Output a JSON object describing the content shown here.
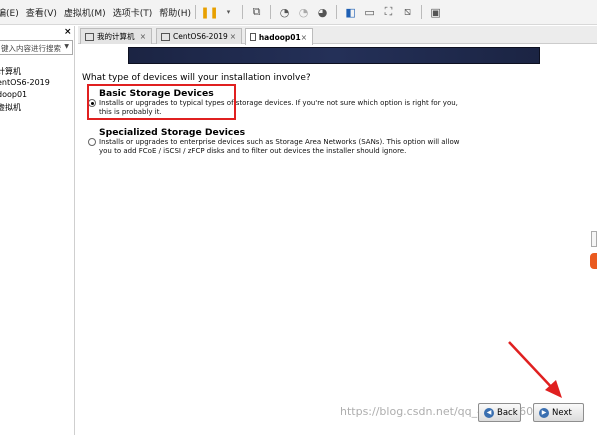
{
  "menubar": {
    "items": [
      "编(E)",
      "查看(V)",
      "虚拟机(M)",
      "选项卡(T)",
      "帮助(H)"
    ]
  },
  "sidebar": {
    "close": "×",
    "search_placeholder": "键入内容进行搜索",
    "tree": [
      "计算机",
      "entOS6-2019",
      "doop01",
      "虚拟机"
    ]
  },
  "tabs": [
    {
      "label": "我的计算机",
      "close": "×"
    },
    {
      "label": "CentOS6-2019",
      "close": "×"
    },
    {
      "label": "hadoop01",
      "close": "×"
    }
  ],
  "installer": {
    "question": "What type of devices will your installation involve?",
    "options": [
      {
        "title": "Basic Storage Devices",
        "desc_1": "Installs or upgrades to typical types of storage devices.  If you're not sure which option is right for you,",
        "desc_2": "this is probably it.",
        "selected": true
      },
      {
        "title": "Specialized Storage Devices",
        "desc_1": "Installs or upgrades to enterprise devices such as Storage Area Networks (SANs). This option will allow",
        "desc_2": "you to add FCoE / iSCSI / zFCP disks and to filter out devices the installer should ignore.",
        "selected": false
      }
    ],
    "back_label": "Back",
    "next_label": "Next"
  },
  "watermark": "https://blog.csdn.net/qq_41563760",
  "colors": {
    "highlight": "#e02020",
    "banner": "#1b2443"
  }
}
